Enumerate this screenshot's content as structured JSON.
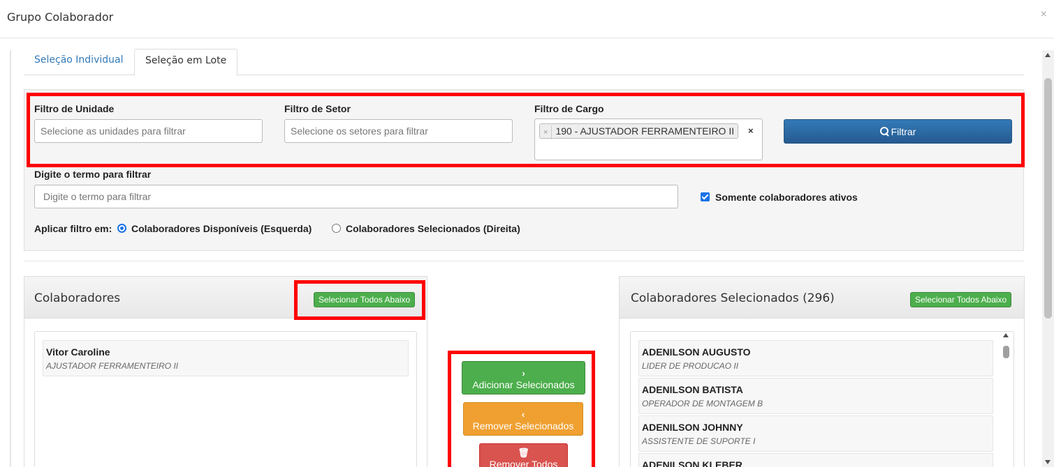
{
  "modal": {
    "title": "Grupo Colaborador",
    "close": "×"
  },
  "tabs": [
    {
      "label": "Seleção Individual",
      "active": false
    },
    {
      "label": "Seleção em Lote",
      "active": true
    }
  ],
  "filters": {
    "unidade": {
      "label": "Filtro de Unidade",
      "placeholder": "Selecione as unidades para filtrar"
    },
    "setor": {
      "label": "Filtro de Setor",
      "placeholder": "Selecione os setores para filtrar"
    },
    "cargo": {
      "label": "Filtro de Cargo",
      "chip": "190 - AJUSTADOR FERRAMENTEIRO II",
      "chip_remove": "×",
      "clear": "×"
    },
    "filter_button": "Filtrar",
    "term": {
      "label": "Digite o termo para filtrar",
      "placeholder": "Digite o termo para filtrar"
    },
    "only_active": {
      "label": "Somente colaboradores ativos",
      "checked": true
    },
    "apply_in": {
      "label": "Aplicar filtro em:",
      "options": [
        {
          "label": "Colaboradores Disponíveis (Esquerda)",
          "selected": true
        },
        {
          "label": "Colaboradores Selecionados (Direita)",
          "selected": false
        }
      ]
    }
  },
  "left_panel": {
    "title": "Colaboradores",
    "select_all": "Selecionar Todos Abaixo",
    "items": [
      {
        "name": "Vitor Caroline",
        "role": "AJUSTADOR FERRAMENTEIRO II"
      }
    ]
  },
  "actions": {
    "add": {
      "glyph": "›",
      "label": "Adicionar Selecionados"
    },
    "remove": {
      "glyph": "‹",
      "label": "Remover Selecionados"
    },
    "remove_all": {
      "glyph": "🗑",
      "label": "Remover Todos"
    }
  },
  "right_panel": {
    "title": "Colaboradores Selecionados (296)",
    "select_all": "Selecionar Todos Abaixo",
    "items": [
      {
        "name": "ADENILSON AUGUSTO",
        "role": "LIDER DE PRODUCAO II"
      },
      {
        "name": "ADENILSON BATISTA",
        "role": "OPERADOR DE MONTAGEM B"
      },
      {
        "name": "ADENILSON JOHNNY",
        "role": "ASSISTENTE DE SUPORTE I"
      },
      {
        "name": "ADENILSON KLEBER",
        "role": ""
      }
    ]
  },
  "colors": {
    "primary": "#337ab7",
    "success": "#4cae4c",
    "warning": "#f0a030",
    "danger": "#d9534f",
    "highlight": "#ff0000"
  }
}
